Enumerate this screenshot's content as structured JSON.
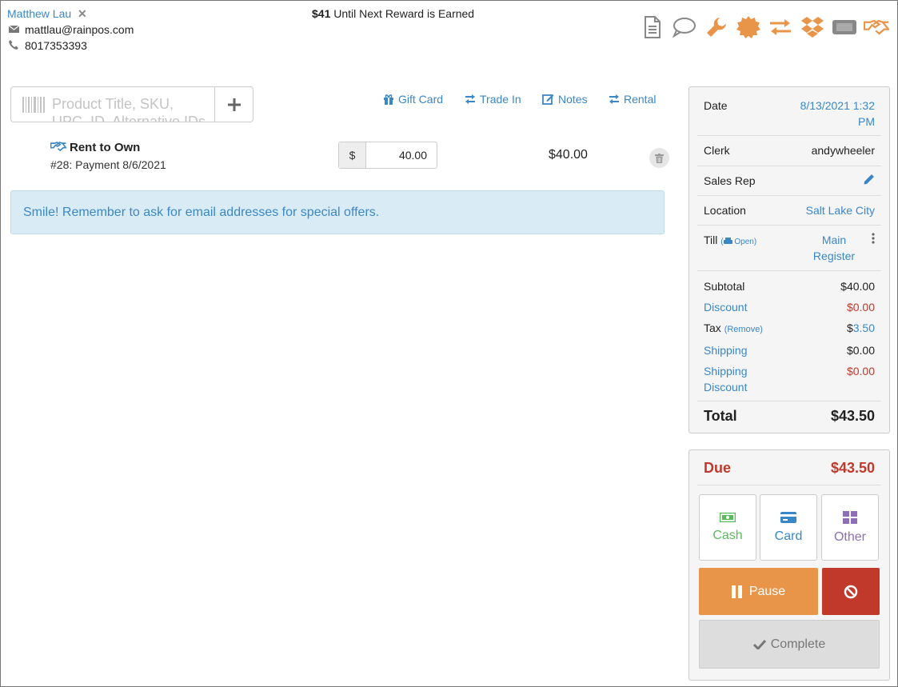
{
  "customer": {
    "name": "Matthew Lau",
    "remove_glyph": "✕",
    "email": "mattlau@rainpos.com",
    "phone": "8017353393"
  },
  "reward": {
    "amount": "$41",
    "text": "Until Next Reward is Earned"
  },
  "top_icons": [
    {
      "name": "document-icon",
      "color": "#888888"
    },
    {
      "name": "chat-icon",
      "color": "#888888"
    },
    {
      "name": "wrench-icon",
      "color": "#e8954a"
    },
    {
      "name": "badge-icon",
      "color": "#e8954a"
    },
    {
      "name": "exchange-icon",
      "color": "#e8954a"
    },
    {
      "name": "dropbox-icon",
      "color": "#e8954a"
    },
    {
      "name": "ticket-icon",
      "color": "#888888"
    },
    {
      "name": "handshake-icon",
      "color": "#e8954a"
    }
  ],
  "search": {
    "placeholder": "Product Title, SKU, UPC, ID, Alternative IDs"
  },
  "actions": {
    "gift_card": "Gift Card",
    "trade_in": "Trade In",
    "notes": "Notes",
    "rental": "Rental"
  },
  "line_item": {
    "title": "Rent to Own",
    "subtitle": "#28: Payment 8/6/2021",
    "currency": "$",
    "price": "40.00",
    "total": "$40.00"
  },
  "notice": "Smile! Remember to ask for email addresses for special offers.",
  "summary": {
    "date_label": "Date",
    "date_value": "8/13/2021 1:32 PM",
    "clerk_label": "Clerk",
    "clerk_value": "andywheeler",
    "sales_rep_label": "Sales Rep",
    "location_label": "Location",
    "location_value": "Salt Lake City",
    "till_label": "Till",
    "till_status": "Open",
    "till_value": "Main Register",
    "subtotal_label": "Subtotal",
    "subtotal_value": "$40.00",
    "discount_label": "Discount",
    "discount_value": "$0.00",
    "tax_label": "Tax",
    "tax_remove": "(Remove)",
    "tax_currency": "$",
    "tax_value": "3.50",
    "shipping_label": "Shipping",
    "shipping_value": "$0.00",
    "shipping_discount_label": "Shipping Discount",
    "shipping_discount_value": "$0.00",
    "total_label": "Total",
    "total_value": "$43.50"
  },
  "payment": {
    "due_label": "Due",
    "due_value": "$43.50",
    "cash": "Cash",
    "card": "Card",
    "other": "Other",
    "pause": "Pause",
    "complete": "Complete",
    "colors": {
      "cash": "#5cb85c",
      "card": "#3a87c8",
      "other": "#8e6fb5",
      "pause": "#e8954a",
      "cancel": "#c0392b"
    }
  }
}
